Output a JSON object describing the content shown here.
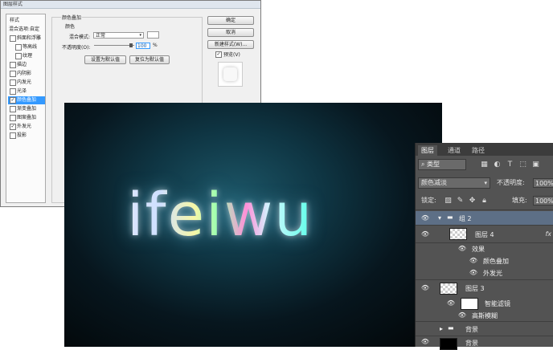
{
  "dialog": {
    "title": "图层样式",
    "styles_header": "样式",
    "blend_options": "混合选项:自定",
    "styles": [
      {
        "label": "斜面和浮雕",
        "checked": false,
        "indent": false
      },
      {
        "label": "等高线",
        "checked": false,
        "indent": true
      },
      {
        "label": "纹理",
        "checked": false,
        "indent": true
      },
      {
        "label": "描边",
        "checked": false,
        "indent": false
      },
      {
        "label": "内阴影",
        "checked": false,
        "indent": false
      },
      {
        "label": "内发光",
        "checked": false,
        "indent": false
      },
      {
        "label": "光泽",
        "checked": false,
        "indent": false
      },
      {
        "label": "颜色叠加",
        "checked": true,
        "indent": false,
        "selected": true
      },
      {
        "label": "渐变叠加",
        "checked": false,
        "indent": false
      },
      {
        "label": "图案叠加",
        "checked": false,
        "indent": false
      },
      {
        "label": "外发光",
        "checked": true,
        "indent": false
      },
      {
        "label": "投影",
        "checked": false,
        "indent": false
      }
    ],
    "section_title": "颜色叠加",
    "section_sub": "颜色",
    "blend_mode_label": "混合模式:",
    "blend_mode_value": "正常",
    "opacity_label": "不透明度(O):",
    "opacity_value": "100",
    "percent": "%",
    "btn_make_default": "设置为默认值",
    "btn_reset_default": "复位为默认值",
    "btn_ok": "确定",
    "btn_cancel": "取消",
    "btn_new_style": "新建样式(W)...",
    "preview_label": "预览(V)",
    "preview_checked": true
  },
  "artwork": {
    "text": "ifeiwu"
  },
  "layers_panel": {
    "tabs": [
      "图层",
      "通道",
      "路径"
    ],
    "kind_filter": "类型",
    "blend_mode": "颜色减淡",
    "opacity_label": "不透明度:",
    "opacity_value": "100%",
    "lock_label": "锁定:",
    "fill_label": "填充:",
    "fill_value": "100%",
    "layers": [
      {
        "name": "组 2",
        "type": "group",
        "selected": true
      },
      {
        "name": "图层 4",
        "type": "layer",
        "fx": "fx"
      },
      {
        "name": "效果",
        "type": "effect-header"
      },
      {
        "name": "颜色叠加",
        "type": "effect"
      },
      {
        "name": "外发光",
        "type": "effect"
      },
      {
        "name": "图层 3",
        "type": "smart"
      },
      {
        "name": "智能滤镜",
        "type": "filter-header"
      },
      {
        "name": "高斯模糊",
        "type": "filter"
      },
      {
        "name": "背景",
        "type": "group"
      },
      {
        "name": "背景",
        "type": "layer"
      }
    ]
  }
}
